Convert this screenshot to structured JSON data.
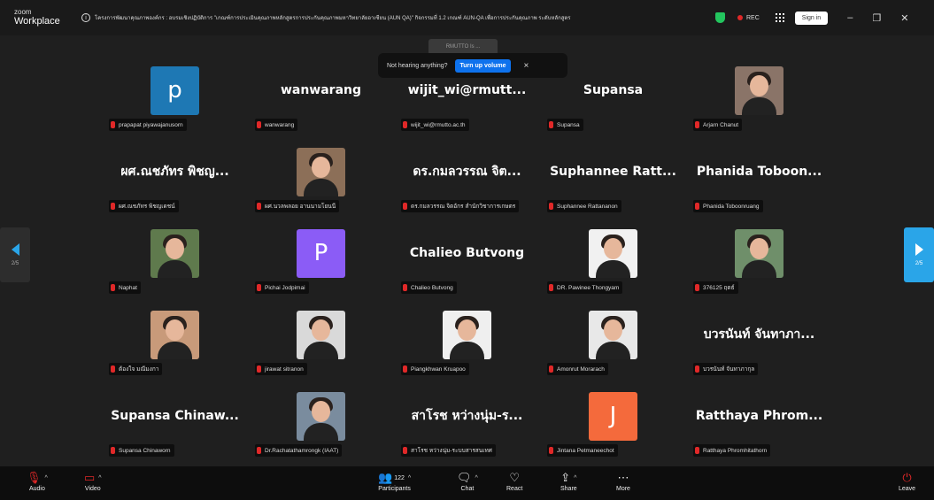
{
  "app": {
    "logo_top": "zoom",
    "logo_bottom": "Workplace"
  },
  "header": {
    "meeting_title": "โครงการพัฒนาคุณภาพองค์กร : อบรมเชิงปฏิบัติการ \"เกณฑ์การประเมินคุณภาพหลักสูตรการประกันคุณภาพมหาวิทยาลัยอาเซียน (AUN QA)\" กิจกรรมที่ 1.2 เกณฑ์ AUN-QA เพื่อการประกันคุณภาพ ระดับหลักสูตร",
    "rec_label": "REC",
    "signin_label": "Sign in",
    "colors": {
      "rec": "#e02828",
      "shield": "#23c55e",
      "accent": "#0e72ed"
    }
  },
  "notification": {
    "ghost_label": "RMUTTO Is ...",
    "text": "Not hearing anything?",
    "button_label": "Turn up volume",
    "close": "×"
  },
  "pager": {
    "left": "2/5",
    "right": "2/5"
  },
  "tiles": [
    {
      "kind": "initial",
      "initial": "p",
      "color": "#1e78b4",
      "label": "prapapat piyawajanusorn"
    },
    {
      "kind": "name",
      "display": "wanwarang",
      "label": "wanwarang"
    },
    {
      "kind": "name",
      "display": "wijit_wi@rmutt...",
      "label": "wijit_wi@rmutto.ac.th"
    },
    {
      "kind": "name",
      "display": "Supansa",
      "label": "Supansa"
    },
    {
      "kind": "photo",
      "bg": "#8a7468",
      "label": "Arjarn Chanut"
    },
    {
      "kind": "name",
      "display": "ผศ.ณชภัทร พิชญ...",
      "label": "ผศ.ณชภัทร พิชญเดชน์"
    },
    {
      "kind": "photo",
      "bg": "#8c6f58",
      "label": "ผศ.นวลพลอย อานนามโยนนี"
    },
    {
      "kind": "name",
      "display": "ดร.กมลวรรณ จิต...",
      "label": "ดร.กมลวรรณ จิตอักร สำนักวิชาการเกษตร"
    },
    {
      "kind": "name",
      "display": "Suphannee Ratt...",
      "label": "Suphannee Rattananon"
    },
    {
      "kind": "name",
      "display": "Phanida Toboon...",
      "label": "Phanida Toboonruang"
    },
    {
      "kind": "photo",
      "bg": "#5f7a4d",
      "label": "Naphat"
    },
    {
      "kind": "initial",
      "initial": "P",
      "color": "#8b5cf6",
      "label": "Pichai Jodpimai"
    },
    {
      "kind": "name",
      "display": "Chalieo Butvong",
      "label": "Chalieo Butvong"
    },
    {
      "kind": "photo",
      "bg": "#f1f1f1",
      "label": "DR. Pawinee Thongyam"
    },
    {
      "kind": "photo",
      "bg": "#6f8f6a",
      "label": "376125 ฤดธ์"
    },
    {
      "kind": "photo",
      "bg": "#c89a7a",
      "label": "ต้องใจ มณีมงกา"
    },
    {
      "kind": "photo",
      "bg": "#d9d9d9",
      "label": "jirawat sitranon"
    },
    {
      "kind": "photo",
      "bg": "#efefef",
      "label": "Piangkhwan Kruapoo"
    },
    {
      "kind": "photo",
      "bg": "#e8e8e8",
      "label": "Amonrut Morarach"
    },
    {
      "kind": "name",
      "display": "บวรนันท์ จันทาภา...",
      "label": "บวรนันท์ จันทาภากุล"
    },
    {
      "kind": "name",
      "display": "Supansa Chinaw...",
      "label": "Supansa Chinaworn"
    },
    {
      "kind": "photo",
      "bg": "#7a8c9e",
      "label": "Dr.Rachatathamrongk (IAAT)"
    },
    {
      "kind": "name",
      "display": "สาโรช หว่างนุ่ม-ร...",
      "label": "สาโรช หว่างนุ่ม-ระบบสารสนเทศ"
    },
    {
      "kind": "initial",
      "initial": "J",
      "color": "#f46a3c",
      "label": "Jintana Petmaneechot"
    },
    {
      "kind": "name",
      "display": "Ratthaya Phrom...",
      "label": "Ratthaya Phromhitathorn"
    }
  ],
  "toolbar": {
    "audio": "Audio",
    "video": "Video",
    "participants": "Participants",
    "participant_count": "122",
    "chat": "Chat",
    "react": "React",
    "share": "Share",
    "more": "More",
    "leave": "Leave"
  }
}
